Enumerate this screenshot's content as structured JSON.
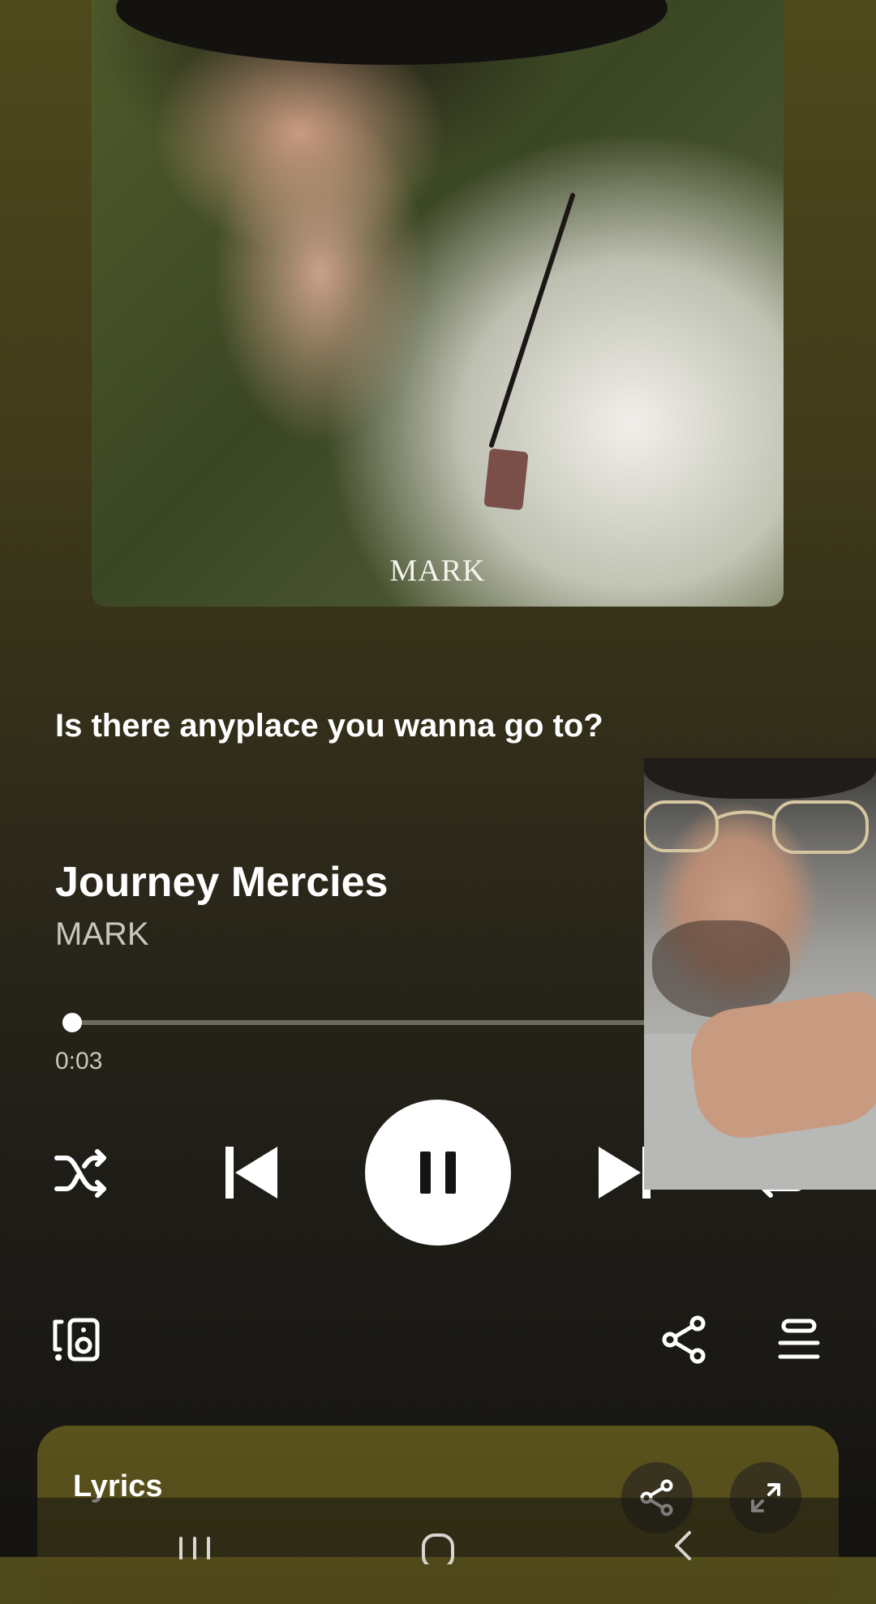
{
  "album": {
    "art_label": "MARK",
    "art_colors": {
      "background": "#3b4724",
      "shirt": "#f1efea",
      "hat": "#141210"
    }
  },
  "lyric_preview": "Is there anyplace you wanna go to?",
  "track": {
    "title": "Journey Mercies",
    "artist": "MARK"
  },
  "playback": {
    "elapsed": "0:03",
    "progress_fraction": 0.01,
    "state": "playing"
  },
  "controls": {
    "shuffle_icon": "shuffle-icon",
    "previous_icon": "skip-previous-icon",
    "pause_icon": "pause-icon",
    "next_icon": "skip-next-icon",
    "repeat_icon": "repeat-icon"
  },
  "secondary_actions": {
    "devices_icon": "connect-device-icon",
    "share_icon": "share-icon",
    "queue_icon": "queue-icon"
  },
  "lyrics_card": {
    "heading": "Lyrics",
    "share_icon": "share-icon",
    "expand_icon": "expand-icon"
  },
  "nav_bar": {
    "recents_icon": "recents-icon",
    "home_icon": "home-icon",
    "back_icon": "back-icon"
  },
  "colors": {
    "accent": "#ffffff",
    "background_top": "#4f4a1c",
    "background_bottom": "#151412",
    "lyrics_card": "#5b531c",
    "muted_text": "#c9c6bc"
  }
}
